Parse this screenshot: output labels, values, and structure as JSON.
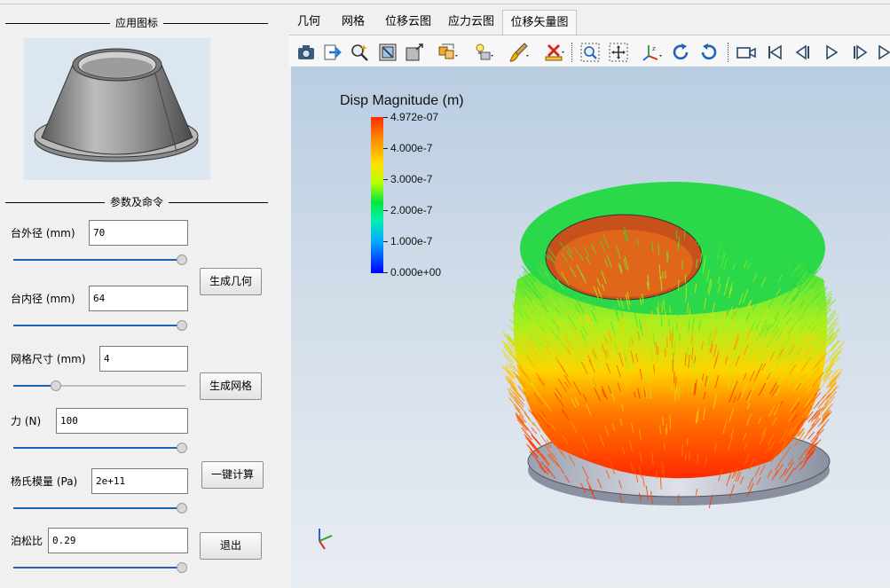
{
  "left": {
    "icon_group_title": "应用图标",
    "params_group_title": "参数及命令",
    "params": {
      "outer_diameter": {
        "label": "台外径 (mm)",
        "value": "70",
        "slider_fraction": 1.0
      },
      "inner_diameter": {
        "label": "台内径 (mm)",
        "value": "64",
        "slider_fraction": 1.0
      },
      "mesh_size": {
        "label": "网格尺寸 (mm)",
        "value": "4",
        "slider_fraction": 0.25
      },
      "force": {
        "label": "力 (N)",
        "value": "100",
        "slider_fraction": 1.0
      },
      "youngs_modulus": {
        "label": "杨氏模量 (Pa)",
        "value": "2e+11",
        "slider_fraction": 1.0
      },
      "poisson_ratio": {
        "label": "泊松比",
        "value": "0.29",
        "slider_fraction": 1.0
      }
    },
    "buttons": {
      "generate_geometry": "生成几何",
      "generate_mesh": "生成网格",
      "compute": "一键计算",
      "exit": "退出"
    }
  },
  "tabs": [
    "几何",
    "网格",
    "位移云图",
    "应力云图",
    "位移矢量图"
  ],
  "active_tab": "位移矢量图",
  "toolbar_icons": [
    "camera-icon",
    "export-icon",
    "zoom-pick-icon",
    "reset-view-icon",
    "box-3d-icon",
    "representation-icon",
    "lighting-icon",
    "brush-icon",
    "clear-icon",
    "zoom-box-icon",
    "pan-icon",
    "axes-icon",
    "rotate-cw-icon",
    "rotate-ccw-icon",
    "video-camera-icon",
    "first-frame-icon",
    "prev-frame-icon",
    "play-icon",
    "next-frame-icon",
    "last-frame-icon"
  ],
  "legend": {
    "title": "Disp Magnitude (m)",
    "max_label": "4.972e-07",
    "labels": [
      "4.000e-7",
      "3.000e-7",
      "2.000e-7",
      "1.000e-7",
      "0.000e+00"
    ]
  },
  "colors": {
    "accent": "#1e64b4",
    "viewport_top": "#b9cde2",
    "viewport_bottom": "#e8edf2"
  }
}
